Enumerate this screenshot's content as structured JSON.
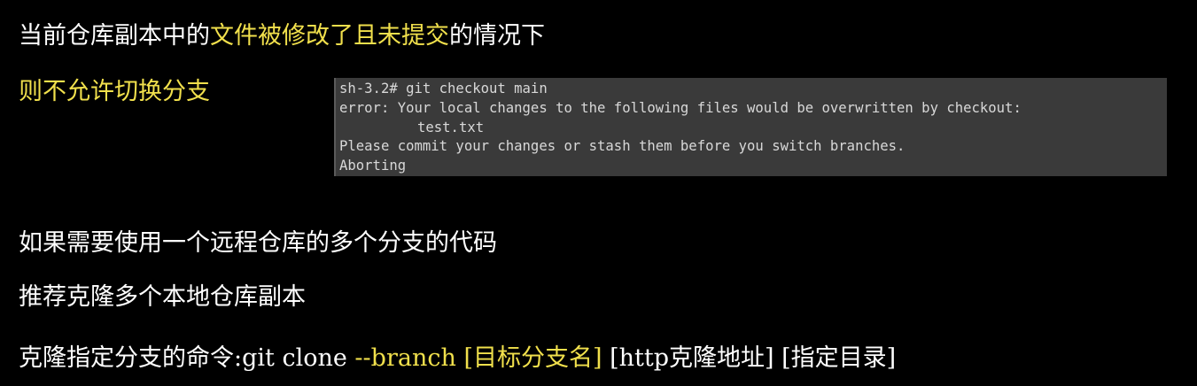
{
  "line1": {
    "prefix": "当前仓库副本中的",
    "highlight": "文件被修改了且未提交",
    "suffix": "的情况下"
  },
  "line2": {
    "text": "则不允许切换分支"
  },
  "terminal": {
    "lines": [
      "sh-3.2# git checkout main",
      "error: Your local changes to the following files would be overwritten by checkout:",
      "test.txt",
      "Please commit your changes or stash them before you switch branches.",
      "Aborting"
    ]
  },
  "line3": {
    "text": "如果需要使用一个远程仓库的多个分支的代码"
  },
  "line4": {
    "text": "推荐克隆多个本地仓库副本"
  },
  "line5": {
    "prefix": "克隆指定分支的命令:git clone ",
    "highlight": "--branch [目标分支名]",
    "suffix": " [http克隆地址] [指定目录]"
  },
  "colors": {
    "background": "#000000",
    "text": "#ffffff",
    "highlight": "#f1e04c",
    "terminal_bg": "#3a3a3a",
    "terminal_text": "#d8d8d8"
  }
}
